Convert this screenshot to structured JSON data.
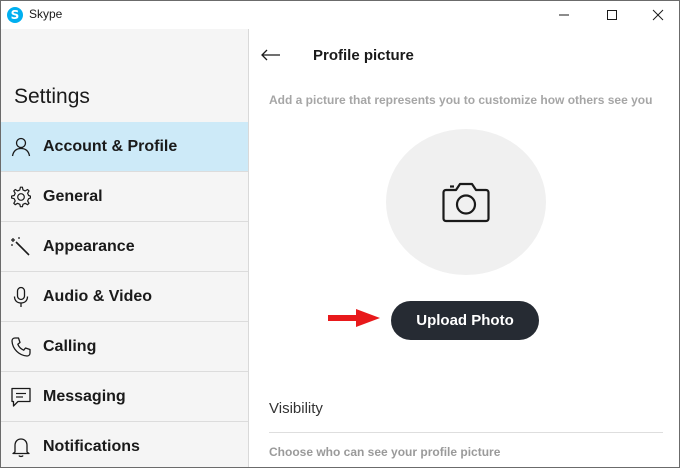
{
  "window": {
    "title": "Skype",
    "logo_glyph": "S"
  },
  "sidebar": {
    "title": "Settings",
    "active_color": "#cdeaf8",
    "items": [
      {
        "label": "Account & Profile",
        "icon": "person-icon",
        "active": true
      },
      {
        "label": "General",
        "icon": "gear-icon",
        "active": false
      },
      {
        "label": "Appearance",
        "icon": "magic-wand-icon",
        "active": false
      },
      {
        "label": "Audio & Video",
        "icon": "microphone-icon",
        "active": false
      },
      {
        "label": "Calling",
        "icon": "phone-icon",
        "active": false
      },
      {
        "label": "Messaging",
        "icon": "chat-icon",
        "active": false
      },
      {
        "label": "Notifications",
        "icon": "bell-icon",
        "active": false
      }
    ]
  },
  "main": {
    "title": "Profile picture",
    "subtitle": "Add a picture that represents you to customize how others see you",
    "avatar_icon": "camera-icon",
    "upload_button": "Upload Photo",
    "annotation_arrow_color": "#e8191b",
    "visibility": {
      "title": "Visibility",
      "description": "Choose who can see your profile picture"
    }
  }
}
